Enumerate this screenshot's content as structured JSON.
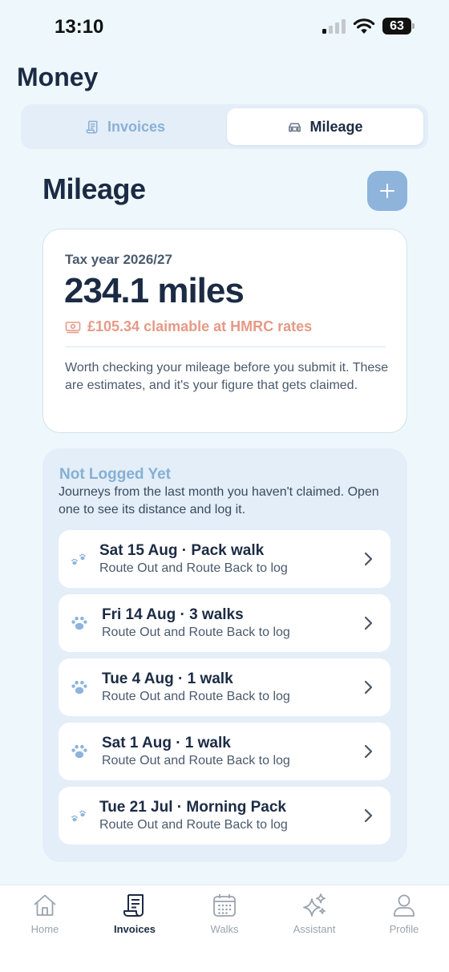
{
  "status_bar": {
    "time": "13:10",
    "battery": "63"
  },
  "screen_title": "Money",
  "segmented": {
    "invoices_label": "Invoices",
    "mileage_label": "Mileage",
    "selected": "Mileage"
  },
  "section": {
    "title": "Mileage"
  },
  "summary": {
    "tax_year": "Tax year 2026/27",
    "miles": "234.1 miles",
    "claimable": "£105.34 claimable at HMRC rates",
    "note": "Worth checking your mileage before you submit it. These are estimates, and it's your figure that gets claimed."
  },
  "pending": {
    "title": "Not Logged Yet",
    "description": "Journeys from the last month you haven't claimed. Open one to see its distance and log it.",
    "items": [
      {
        "title": "Sat 15 Aug · Pack walk",
        "subtitle": "Route Out and Route Back to log",
        "icon": "paw-pair-icon"
      },
      {
        "title": "Fri 14 Aug · 3 walks",
        "subtitle": "Route Out and Route Back to log",
        "icon": "paw-icon"
      },
      {
        "title": "Tue 4 Aug · 1 walk",
        "subtitle": "Route Out and Route Back to log",
        "icon": "paw-icon"
      },
      {
        "title": "Sat 1 Aug · 1 walk",
        "subtitle": "Route Out and Route Back to log",
        "icon": "paw-icon"
      },
      {
        "title": "Tue 21 Jul · Morning Pack",
        "subtitle": "Route Out and Route Back to log",
        "icon": "paw-pair-icon"
      }
    ]
  },
  "tab_bar": {
    "items": [
      {
        "label": "Home",
        "icon": "home-icon"
      },
      {
        "label": "Invoices",
        "icon": "receipt-icon",
        "active": true
      },
      {
        "label": "Walks",
        "icon": "calendar-icon"
      },
      {
        "label": "Assistant",
        "icon": "sparkles-icon"
      },
      {
        "label": "Profile",
        "icon": "person-icon"
      }
    ]
  },
  "colors": {
    "background": "#eef8fc",
    "accent": "#8eb4dc",
    "claimable": "#e59a86",
    "text_primary": "#1c2b44"
  }
}
